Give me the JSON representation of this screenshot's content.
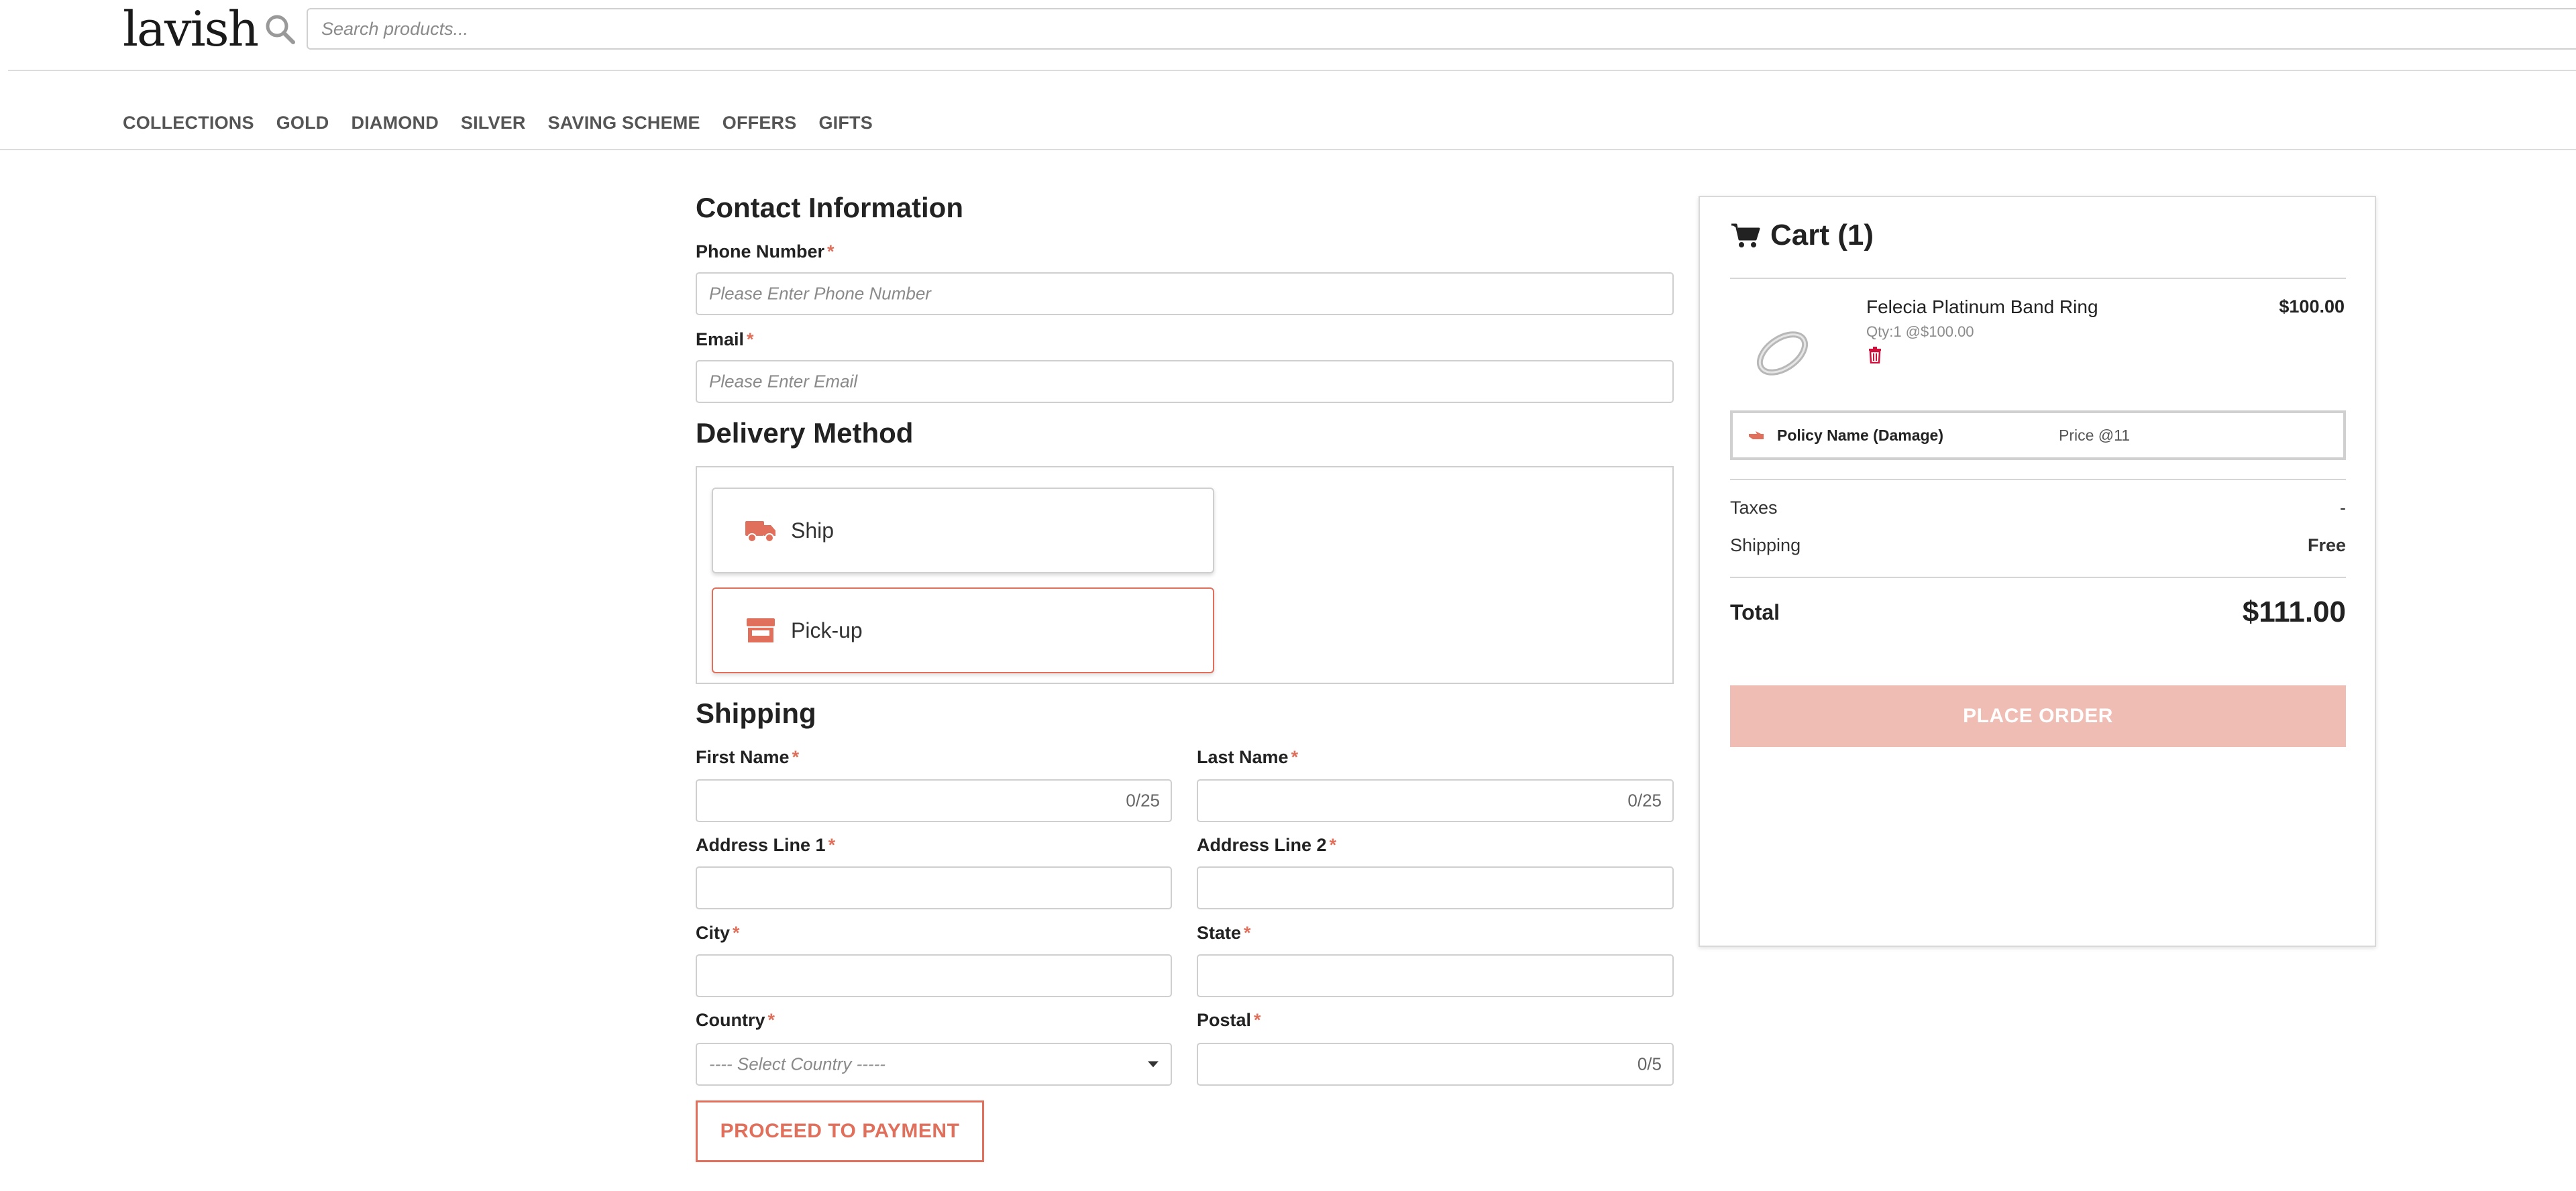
{
  "header": {
    "logo": "lavish",
    "search_placeholder": "Search products..."
  },
  "nav": {
    "items": [
      "COLLECTIONS",
      "GOLD",
      "DIAMOND",
      "SILVER",
      "SAVING SCHEME",
      "OFFERS",
      "GIFTS"
    ]
  },
  "contact": {
    "title": "Contact Information",
    "phone_label": "Phone Number",
    "phone_placeholder": "Please Enter Phone Number",
    "email_label": "Email",
    "email_placeholder": "Please Enter Email",
    "required_mark": "*"
  },
  "delivery": {
    "title": "Delivery Method",
    "options": [
      {
        "label": "Ship",
        "icon": "truck-icon",
        "selected": false
      },
      {
        "label": "Pick-up",
        "icon": "store-icon",
        "selected": true
      }
    ]
  },
  "shipping": {
    "title": "Shipping",
    "first_name_label": "First Name",
    "first_name_counter": "0/25",
    "last_name_label": "Last Name",
    "last_name_counter": "0/25",
    "address1_label": "Address Line 1",
    "address2_label": "Address Line 2",
    "city_label": "City",
    "state_label": "State",
    "country_label": "Country",
    "country_selected": "---- Select Country -----",
    "postal_label": "Postal",
    "postal_counter": "0/5",
    "proceed_button": "PROCEED TO PAYMENT"
  },
  "cart": {
    "title": "Cart (1)",
    "item": {
      "name": "Felecia Platinum Band Ring",
      "qty": "Qty:1 @$100.00",
      "price": "$100.00"
    },
    "policy": {
      "name": "Policy Name (Damage)",
      "price": "Price @11"
    },
    "taxes_label": "Taxes",
    "taxes_value": "-",
    "shipping_label": "Shipping",
    "shipping_value": "Free",
    "total_label": "Total",
    "total_value": "$111.00",
    "place_order": "PLACE ORDER"
  },
  "colors": {
    "accent": "#e0705c",
    "accent_light": "#f0bdb4",
    "border": "#cfcfcf"
  }
}
